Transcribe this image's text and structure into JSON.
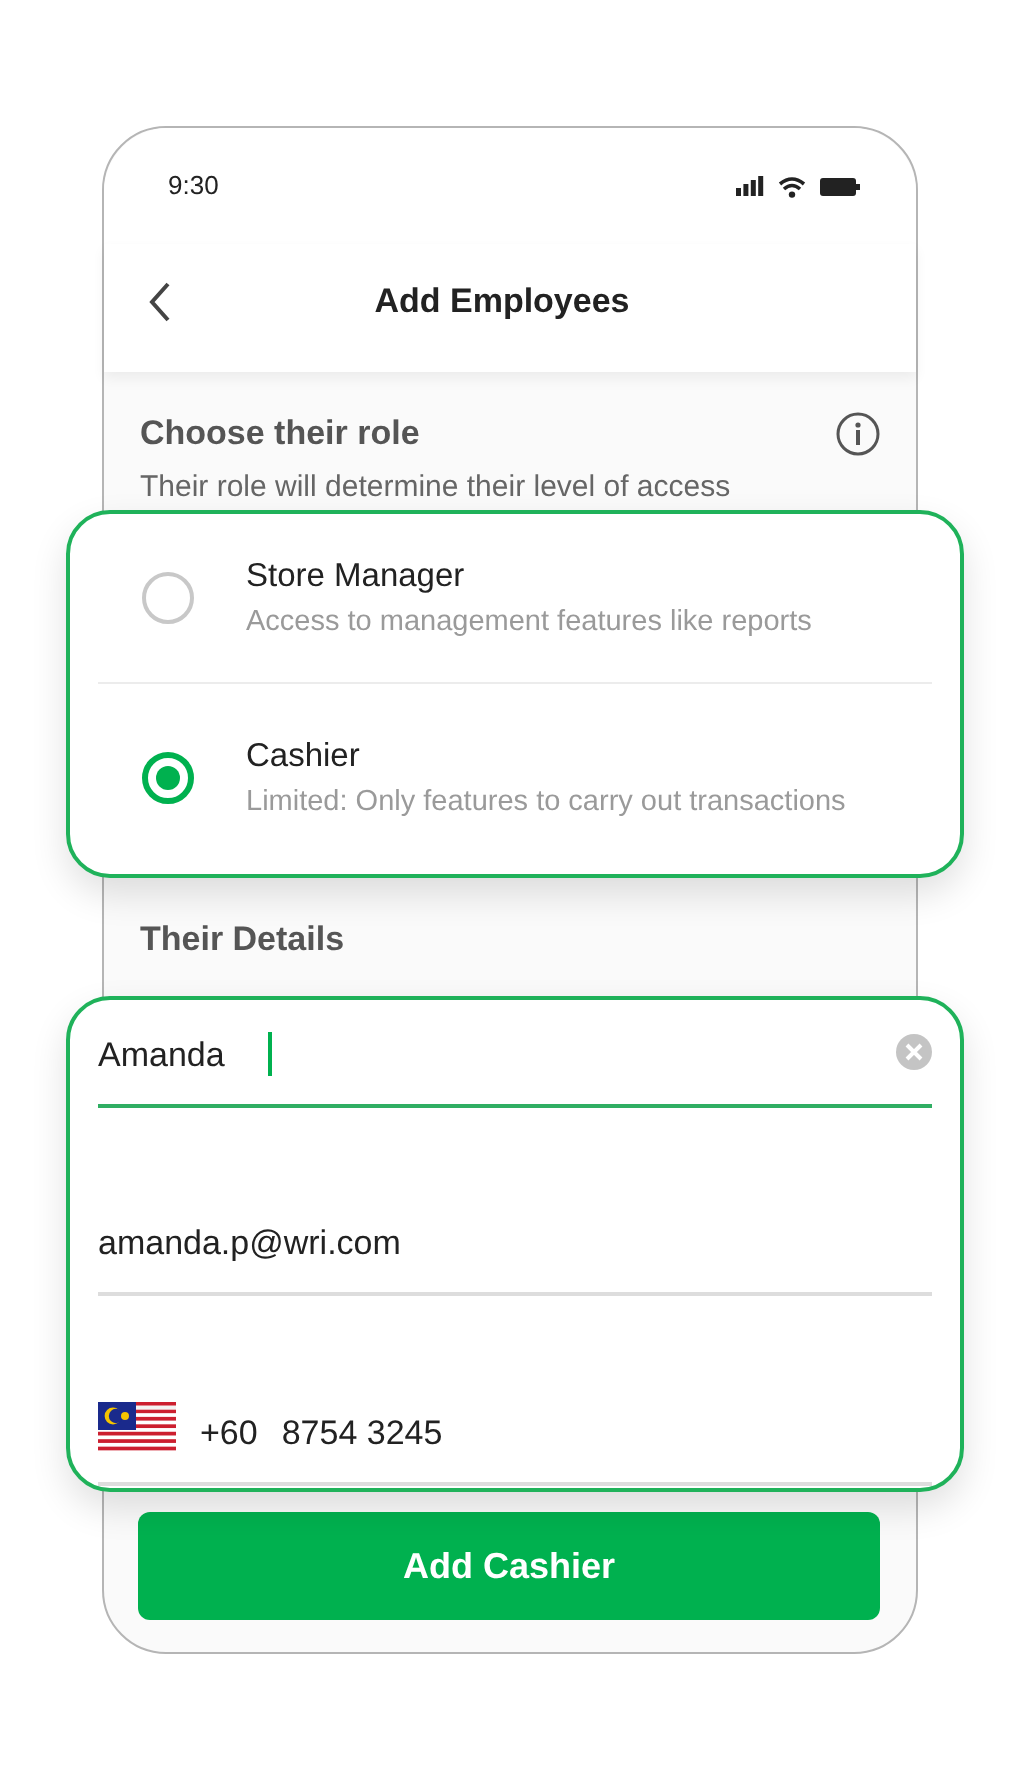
{
  "status_bar": {
    "time": "9:30"
  },
  "header": {
    "title": "Add Employees"
  },
  "role_section": {
    "title": "Choose their role",
    "subtitle": "Their role will determine their level of access"
  },
  "roles": [
    {
      "name": "Store Manager",
      "description": "Access to management features like reports",
      "selected": false
    },
    {
      "name": "Cashier",
      "description": "Limited: Only features to carry out transactions",
      "selected": true
    }
  ],
  "details_section": {
    "title": "Their Details"
  },
  "fields": [
    {
      "kind": "text",
      "value": "Amanda",
      "focused": true
    },
    {
      "kind": "email",
      "value": "amanda.p@wri.com",
      "focused": false
    },
    {
      "kind": "phone",
      "code": "+60",
      "value": "8754 3245",
      "focused": false
    }
  ],
  "submit_button": {
    "label": "Add Cashier"
  }
}
